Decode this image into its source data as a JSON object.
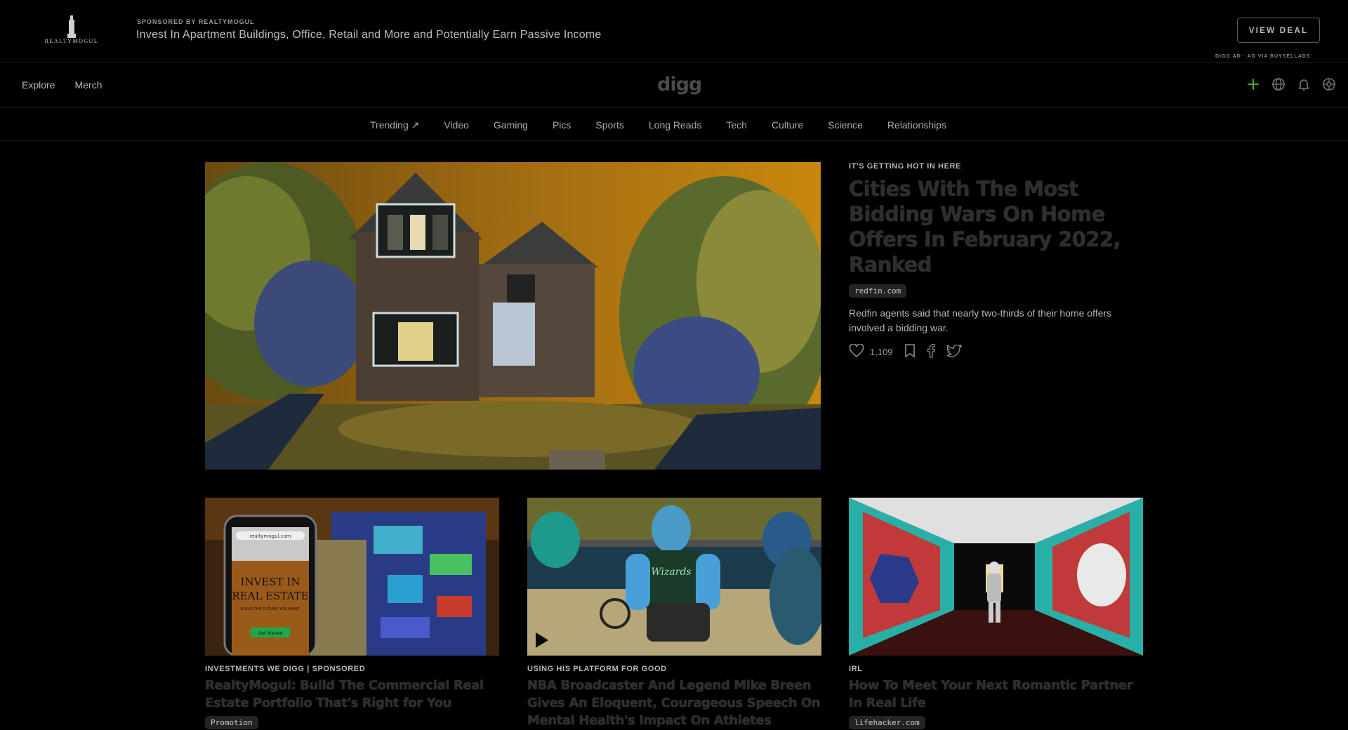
{
  "ad": {
    "logo_text": "REALTYMOGUL",
    "sponsor_label": "SPONSORED BY REALTYMOGUL",
    "headline": "Invest In Apartment Buildings, Office, Retail and More and Potentially Earn Passive Income",
    "cta_label": "VIEW DEAL",
    "note": "DIGG AD · AD VIA BUYSELLADS"
  },
  "header": {
    "nav": [
      {
        "label": "Explore"
      },
      {
        "label": "Merch"
      }
    ],
    "logo": "digg",
    "icons": [
      "add-icon",
      "globe-icon",
      "bell-icon",
      "settings-icon"
    ],
    "accent": "#4caf32"
  },
  "categories": [
    {
      "label": "Trending ↗"
    },
    {
      "label": "Video"
    },
    {
      "label": "Gaming"
    },
    {
      "label": "Pics"
    },
    {
      "label": "Sports"
    },
    {
      "label": "Long Reads"
    },
    {
      "label": "Tech"
    },
    {
      "label": "Culture"
    },
    {
      "label": "Science"
    },
    {
      "label": "Relationships"
    }
  ],
  "hero": {
    "kicker": "IT'S GETTING HOT IN HERE",
    "title": "Cities With The Most Bidding Wars On Home Offers In February 2022, Ranked",
    "source": "redfin.com",
    "description": "Redfin agents said that nearly two-thirds of their home offers involved a bidding war.",
    "likes": "1,109"
  },
  "cards": [
    {
      "kicker": "INVESTMENTS WE DIGG | SPONSORED",
      "title": "RealtyMogul: Build The Commercial Real Estate Portfolio That's Right for You",
      "source": "Promotion",
      "phone_text_1": "INVEST IN",
      "phone_text_2": "REAL ESTATE",
      "phone_sub": "BUILD THE FUTURE YOU WANT",
      "phone_url": "realtymogul.com",
      "phone_button": "Get Started"
    },
    {
      "kicker": "USING HIS PLATFORM FOR GOOD",
      "title": "NBA Broadcaster And Legend Mike Breen Gives An Eloquent, Courageous Speech On Mental Health's Impact On Athletes",
      "source": "",
      "jersey": "Wizards"
    },
    {
      "kicker": "IRL",
      "title": "How To Meet Your Next Romantic Partner In Real Life",
      "source": "lifehacker.com"
    }
  ]
}
